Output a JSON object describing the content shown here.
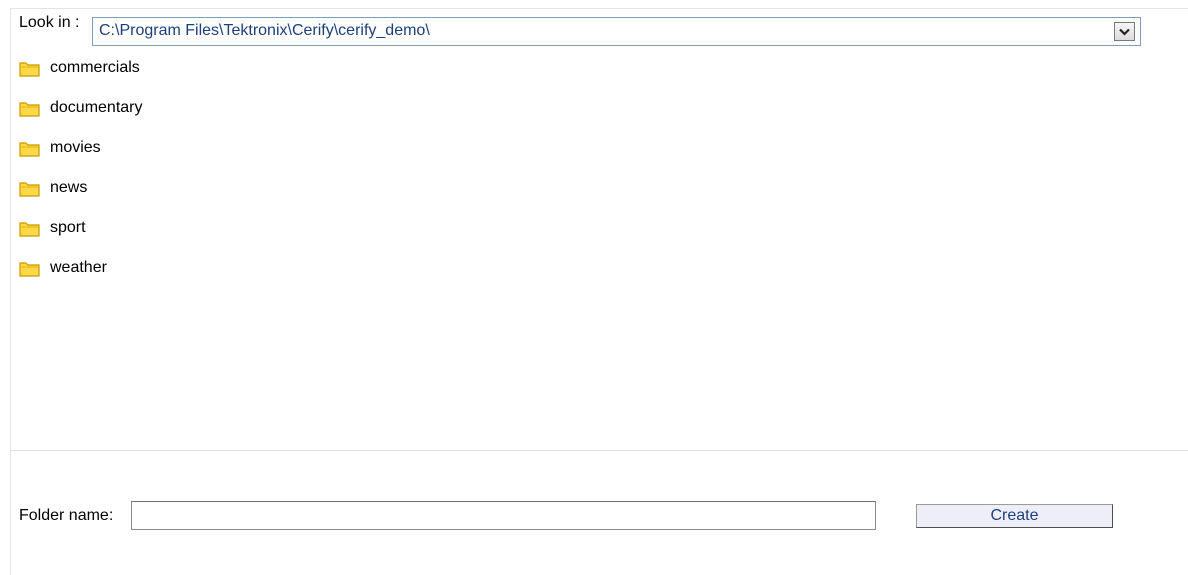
{
  "look_in": {
    "label": "Look in :",
    "value": "C:\\Program Files\\Tektronix\\Cerify\\cerify_demo\\",
    "dropdown_icon": "chevron-down-icon"
  },
  "folders": [
    {
      "label": "commercials",
      "icon": "folder-icon"
    },
    {
      "label": "documentary",
      "icon": "folder-icon"
    },
    {
      "label": "movies",
      "icon": "folder-icon"
    },
    {
      "label": "news",
      "icon": "folder-icon"
    },
    {
      "label": "sport",
      "icon": "folder-icon"
    },
    {
      "label": "weather",
      "icon": "folder-icon"
    }
  ],
  "folder_name": {
    "label": "Folder name:",
    "value": "",
    "placeholder": ""
  },
  "create_button": {
    "label": "Create"
  },
  "colors": {
    "path_text": "#1c3f7a",
    "button_bg": "#eeeef8",
    "folder_fill": "#ffd84a",
    "folder_outline": "#c89a00"
  }
}
